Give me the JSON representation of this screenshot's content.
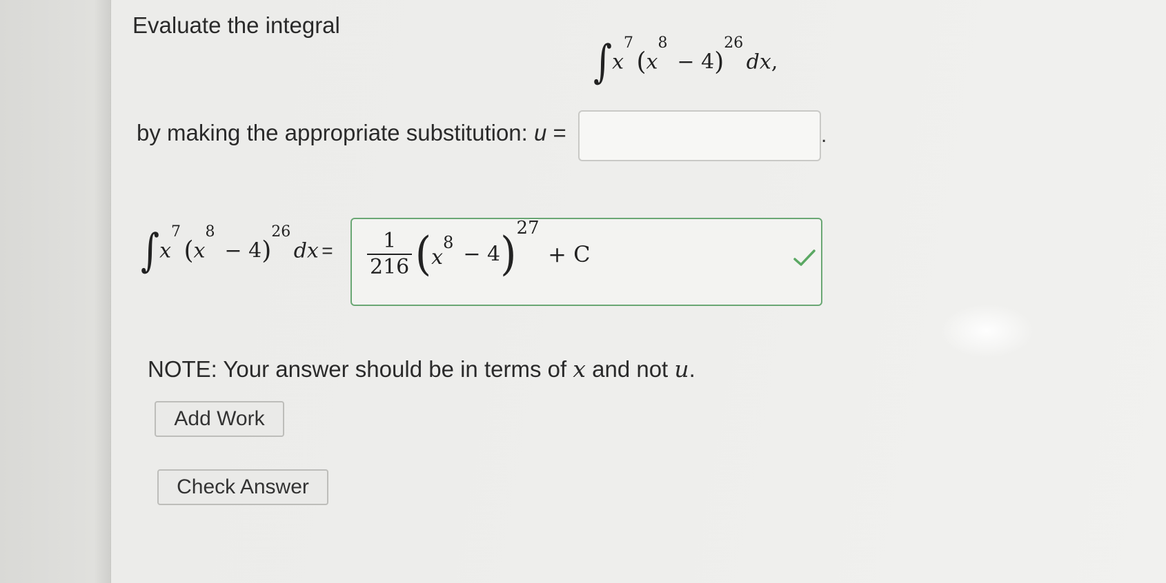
{
  "problem": {
    "intro": "Evaluate the integral",
    "integral_display": {
      "integrand_var": "x",
      "outer_power": "7",
      "inner_power": "8",
      "constant": "4",
      "exponent": "26",
      "differential": "dx",
      "trailing": ","
    },
    "substitution_prompt": "by making the appropriate substitution:",
    "u_label": "u",
    "equals": "=",
    "substitution_value": "",
    "period": "."
  },
  "answer": {
    "fraction_num": "1",
    "fraction_den": "216",
    "inner_var": "x",
    "inner_power": "8",
    "inner_constant": "4",
    "outer_power": "27",
    "constant_term": "+ C",
    "status": "correct",
    "status_color": "#5aa863"
  },
  "note": {
    "prefix": "NOTE: Your answer should be in terms of",
    "var1": "x",
    "middle": "and not",
    "var2": "u",
    "suffix": "."
  },
  "buttons": {
    "add_work": "Add Work",
    "check_answer": "Check Answer"
  }
}
